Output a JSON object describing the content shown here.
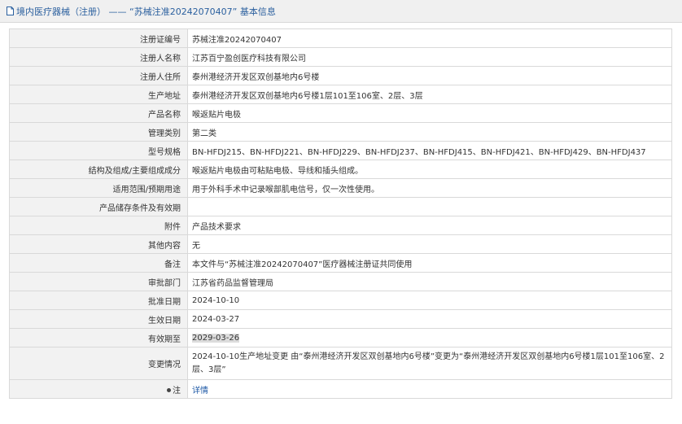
{
  "header": {
    "title": "境内医疗器械（注册） —— “苏械注准20242070407” 基本信息",
    "icon": "document-icon"
  },
  "rows": [
    {
      "label": "注册证编号",
      "value": "苏械注准20242070407"
    },
    {
      "label": "注册人名称",
      "value": "江苏百宁盈创医疗科技有限公司"
    },
    {
      "label": "注册人住所",
      "value": "泰州港经济开发区双创基地内6号楼"
    },
    {
      "label": "生产地址",
      "value": "泰州港经济开发区双创基地内6号楼1层101至106室、2层、3层"
    },
    {
      "label": "产品名称",
      "value": "喉返贴片电极"
    },
    {
      "label": "管理类别",
      "value": "第二类"
    },
    {
      "label": "型号规格",
      "value": "BN-HFDJ215、BN-HFDJ221、BN-HFDJ229、BN-HFDJ237、BN-HFDJ415、BN-HFDJ421、BN-HFDJ429、BN-HFDJ437"
    },
    {
      "label": "结构及组成/主要组成成分",
      "value": "喉返贴片电极由可粘贴电极、导线和插头组成。"
    },
    {
      "label": "适用范围/预期用途",
      "value": "用于外科手术中记录喉部肌电信号，仅一次性使用。"
    },
    {
      "label": "产品储存条件及有效期",
      "value": ""
    },
    {
      "label": "附件",
      "value": "产品技术要求"
    },
    {
      "label": "其他内容",
      "value": "无"
    },
    {
      "label": "备注",
      "value": "本文件与“苏械注准20242070407”医疗器械注册证共同使用"
    },
    {
      "label": "审批部门",
      "value": "江苏省药品监督管理局"
    },
    {
      "label": "批准日期",
      "value": "2024-10-10"
    },
    {
      "label": "生效日期",
      "value": "2024-03-27"
    },
    {
      "label": "有效期至",
      "value": "2029-03-26"
    },
    {
      "label": "变更情况",
      "value": "2024-10-10生产地址变更 由“泰州港经济开发区双创基地内6号楼”变更为“泰州港经济开发区双创基地内6号楼1层101至106室、2层、3层”"
    },
    {
      "label": "注",
      "value": "详情"
    }
  ]
}
